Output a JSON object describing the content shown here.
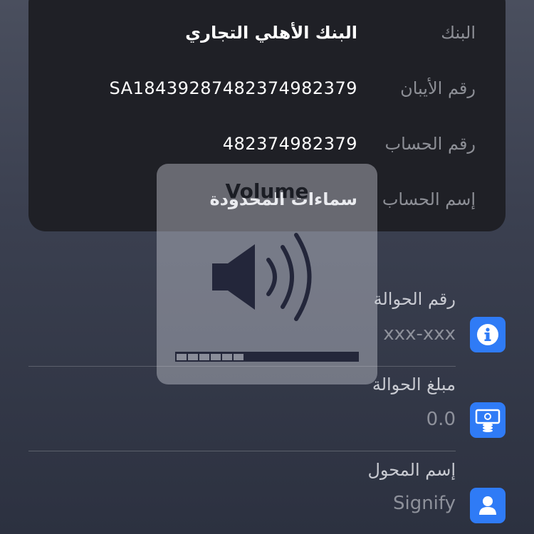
{
  "bank_card": {
    "rows": [
      {
        "label": "البنك",
        "value": "البنك الأهلي التجاري"
      },
      {
        "label": "رقم الأيبان",
        "value": "SA18439287482374982379"
      },
      {
        "label": "رقم الحساب",
        "value": "482374982379"
      },
      {
        "label": "إسم الحساب",
        "value": "سماءات المحدودة"
      }
    ]
  },
  "transfer_info": {
    "items": [
      {
        "label": "رقم الحوالة",
        "value": "xxx-xxx",
        "icon": "info-icon"
      },
      {
        "label": "مبلغ الحوالة",
        "value": "0.0",
        "icon": "money-icon"
      },
      {
        "label": "إسم المحول",
        "value": "Signify",
        "icon": "user-icon"
      }
    ]
  },
  "volume_hud": {
    "title": "Volume",
    "level_segments": 6,
    "total_segments": 16,
    "level_fraction": 0.375
  },
  "colors": {
    "accent": "#2f7bf6",
    "card_bg": "#1f2026",
    "label_gray": "#8d8f96"
  }
}
